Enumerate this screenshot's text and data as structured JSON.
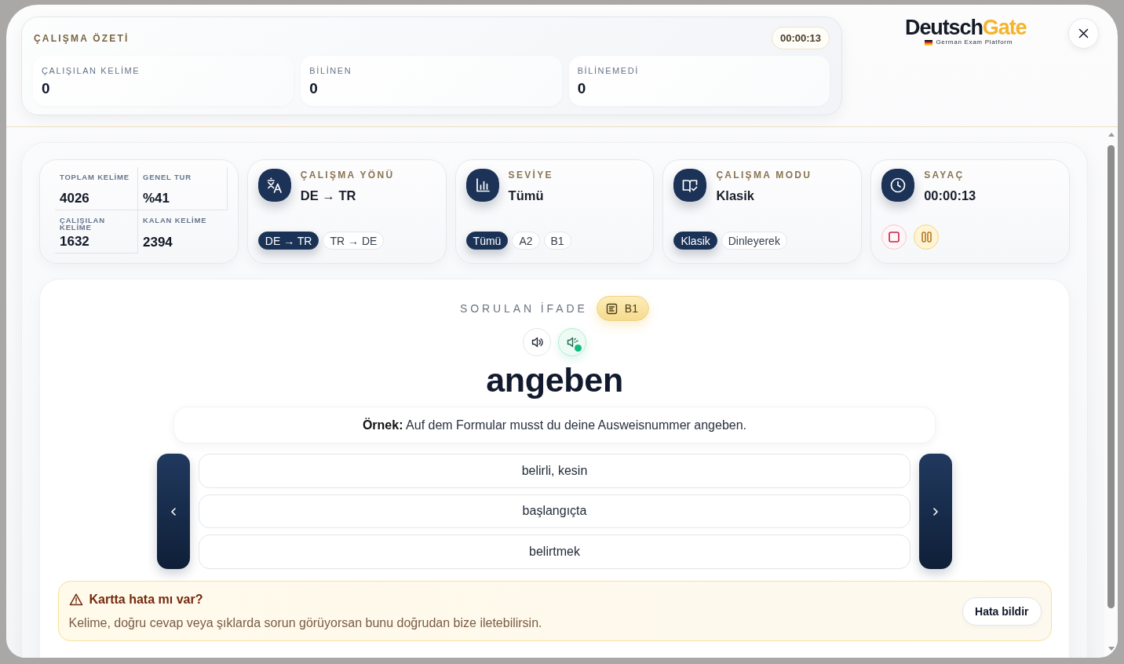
{
  "summary": {
    "title": "ÇALIŞMA ÖZETİ",
    "timer": "00:00:13",
    "stats": [
      {
        "label": "ÇALIŞILAN KELİME",
        "value": "0"
      },
      {
        "label": "BİLİNEN",
        "value": "0"
      },
      {
        "label": "BİLİNEMEDİ",
        "value": "0"
      }
    ]
  },
  "logo": {
    "primary": "Deutsch",
    "accent": "Gate",
    "tagline": "German Exam Platform"
  },
  "overview": [
    {
      "label": "TOPLAM KELİME",
      "value": "4026"
    },
    {
      "label": "GENEL TUR",
      "value": "%41"
    },
    {
      "label": "ÇALIŞILAN KELİME",
      "value": "1632"
    },
    {
      "label": "KALAN KELİME",
      "value": "2394"
    }
  ],
  "settings": [
    {
      "kind": "direction",
      "title": "ÇALIŞMA YÖNÜ",
      "value": "DE → TR",
      "options": [
        {
          "label": "DE → TR",
          "selected": true
        },
        {
          "label": "TR → DE",
          "selected": false
        }
      ]
    },
    {
      "kind": "level",
      "title": "SEVİYE",
      "value": "Tümü",
      "options": [
        {
          "label": "Tümü",
          "selected": true
        },
        {
          "label": "A2",
          "selected": false
        },
        {
          "label": "B1",
          "selected": false
        }
      ]
    },
    {
      "kind": "mode",
      "title": "ÇALIŞMA MODU",
      "value": "Klasik",
      "options": [
        {
          "label": "Klasik",
          "selected": true
        },
        {
          "label": "Dinleyerek",
          "selected": false
        }
      ]
    },
    {
      "kind": "timer",
      "title": "SAYAÇ",
      "value": "00:00:13"
    }
  ],
  "question": {
    "heading": "SORULAN İFADE",
    "level": "B1",
    "audio_buttons": [
      {
        "kind": "play",
        "active": false
      },
      {
        "kind": "slow",
        "active": true
      }
    ],
    "word": "angeben",
    "example": "**Örnek:** Auf dem Formular musst du deine Ausweisnummer angeben.",
    "options": [
      {
        "label": "belirli, kesin",
        "selected": false
      },
      {
        "label": "başlangıçta",
        "selected": false
      },
      {
        "label": "belirtmek",
        "selected": false
      }
    ]
  },
  "report": {
    "title": "Kartta hata mı var?",
    "text": "Kelime, doğru cevap veya şıklarda sorun görüyorsan bunu doğrudan bize iletebilirsin.",
    "button": "Hata bildir"
  }
}
